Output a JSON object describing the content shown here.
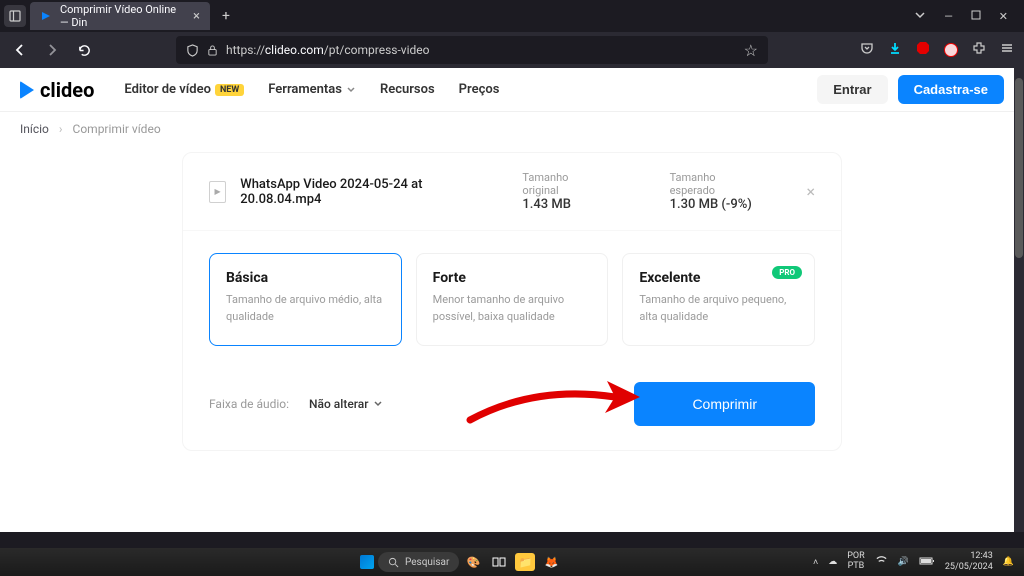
{
  "browser": {
    "tab_title": "Comprimir Vídeo Online — Din",
    "url_prefix": "https://",
    "url_domain": "clideo.com",
    "url_path": "/pt/compress-video"
  },
  "topnav": {
    "brand": "clideo",
    "items": [
      {
        "label": "Editor de vídeo",
        "badge": "NEW"
      },
      {
        "label": "Ferramentas"
      },
      {
        "label": "Recursos"
      },
      {
        "label": "Preços"
      }
    ],
    "login": "Entrar",
    "signup": "Cadastra-se"
  },
  "breadcrumb": {
    "home": "Início",
    "current": "Comprimir vídeo"
  },
  "file": {
    "name": "WhatsApp Video 2024-05-24 at 20.08.04.mp4",
    "original_label": "Tamanho original",
    "original_size": "1.43 MB",
    "expected_label": "Tamanho esperado",
    "expected_size": "1.30 MB (-9%)"
  },
  "options": [
    {
      "title": "Básica",
      "desc": "Tamanho de arquivo médio, alta qualidade"
    },
    {
      "title": "Forte",
      "desc": "Menor tamanho de arquivo possível, baixa qualidade"
    },
    {
      "title": "Excelente",
      "desc": "Tamanho de arquivo pequeno, alta qualidade",
      "badge": "PRO"
    }
  ],
  "audio_row": {
    "label": "Faixa de áudio:",
    "value": "Não alterar"
  },
  "compress": "Comprimir",
  "taskbar": {
    "search_placeholder": "Pesquisar",
    "lang": "POR\nPTB",
    "time": "12:43",
    "date": "25/05/2024"
  }
}
